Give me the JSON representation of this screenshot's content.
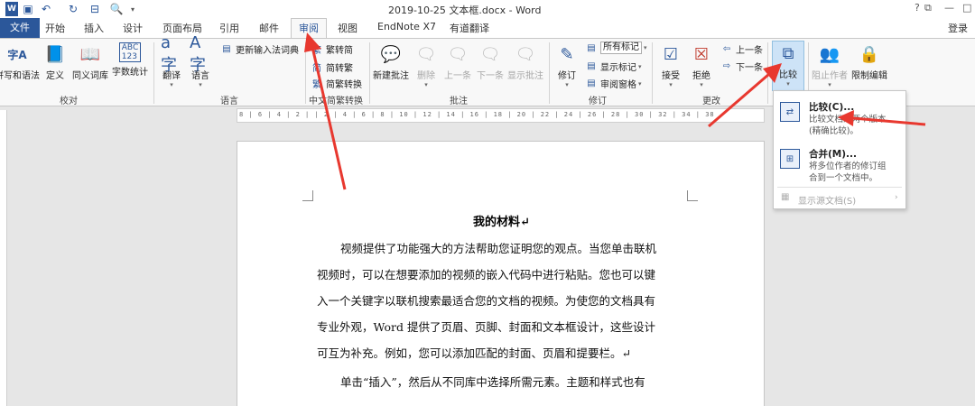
{
  "window": {
    "title": "2019-10-25 文本框.docx - Word",
    "controls": [
      "?",
      "⧉",
      "—",
      "□"
    ],
    "user": "登录"
  },
  "tabs": [
    "文件",
    "开始",
    "插入",
    "设计",
    "页面布局",
    "引用",
    "邮件",
    "审阅",
    "视图",
    "EndNote X7",
    "有道翻译"
  ],
  "active_tab": "审阅",
  "ribbon": {
    "proofing": {
      "group": "校对",
      "buttons": [
        "拼写和语法",
        "定义",
        "同义词库",
        "字数统计"
      ]
    },
    "language": {
      "group": "语言",
      "buttons": [
        "翻译",
        "语言"
      ],
      "update_ime": "更新输入法词典"
    },
    "chinese_conversion": {
      "group": "中文简繁转换",
      "items": [
        "繁转简",
        "简转繁",
        "简繁转换"
      ]
    },
    "comments": {
      "group": "批注",
      "buttons": [
        "新建批注",
        "删除",
        "上一条",
        "下一条",
        "显示批注"
      ]
    },
    "tracking": {
      "group": "修订",
      "button": "修订",
      "markup_select": "所有标记",
      "show_markup": "显示标记",
      "reviewing_pane": "审阅窗格"
    },
    "changes": {
      "group": "更改",
      "buttons": [
        "接受",
        "拒绝"
      ],
      "previous": "上一条",
      "next": "下一条"
    },
    "compare": {
      "button": "比较"
    },
    "protect": {
      "buttons": [
        "阻止作者",
        "限制编辑"
      ]
    }
  },
  "ruler": {
    "text": "8 | 6 | 4 | 2 | | 2 | 4 | 6 | 8 | 10 | 12 | 14 | 16 | 18 | 20 | 22 | 24 | 26 | 28 | 30 | 32 | 34 | 38"
  },
  "dropdown": {
    "items": [
      {
        "title": "比较(C)...",
        "desc": [
          "比较文档的两个版本",
          "(精确比较)。"
        ]
      },
      {
        "title": "合并(M)...",
        "desc": [
          "将多位作者的修订组",
          "合到一个文档中。"
        ]
      }
    ],
    "show_source": "显示源文档(S)"
  },
  "document": {
    "title": "我的材料↵",
    "lines": [
      "视频提供了功能强大的方法帮助您证明您的观点。当您单击联机",
      "视频时，可以在想要添加的视频的嵌入代码中进行粘贴。您也可以键",
      "入一个关键字以联机搜索最适合您的文档的视频。为使您的文档具有",
      "专业外观，Word 提供了页眉、页脚、封面和文本框设计，这些设计",
      "可互为补充。例如，您可以添加匹配的封面、页眉和提要栏。↵",
      "单击“插入”，然后从不同库中选择所需元素。主题和样式也有"
    ]
  },
  "colors": {
    "accent": "#2b579a",
    "annotation_arrow": "#e8382f"
  }
}
